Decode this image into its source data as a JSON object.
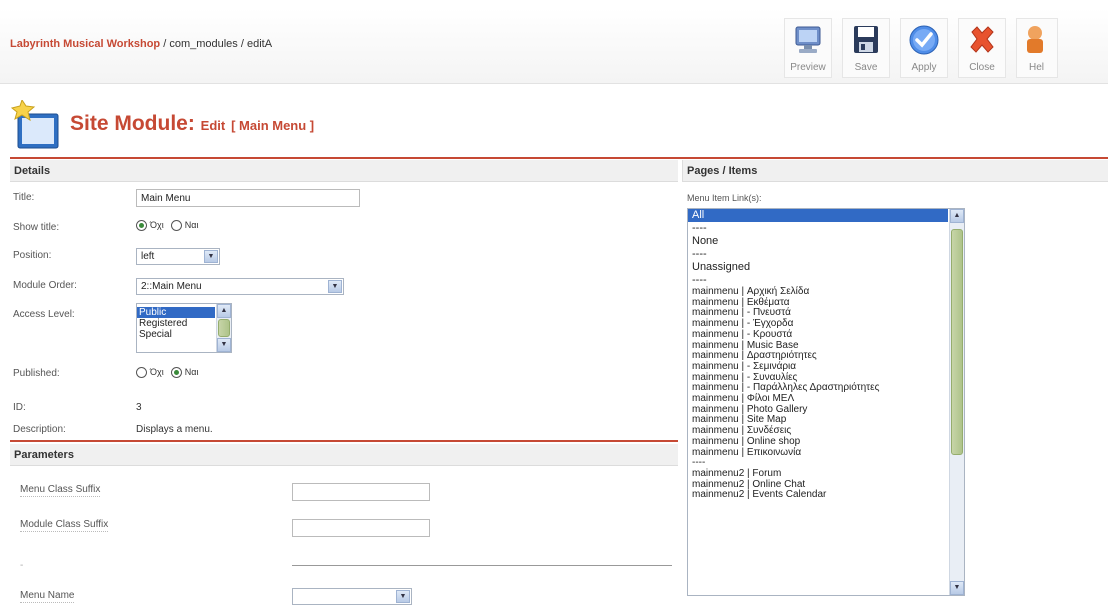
{
  "breadcrumb": {
    "site": "Labyrinth Musical Workshop",
    "path": " / com_modules / editA"
  },
  "toolbar": [
    {
      "name": "preview-button",
      "icon": "monitor-icon",
      "label": "Preview"
    },
    {
      "name": "save-button",
      "icon": "floppy-disk-icon",
      "label": "Save"
    },
    {
      "name": "apply-button",
      "icon": "checkmark-icon",
      "label": "Apply"
    },
    {
      "name": "close-button",
      "icon": "close-x-icon",
      "label": "Close"
    },
    {
      "name": "help-button",
      "icon": "help-person-icon",
      "label": "Hel"
    }
  ],
  "header": {
    "title": "Site Module: ",
    "edit": "Edit",
    "module": "[ Main Menu ]"
  },
  "details": {
    "heading": "Details",
    "title_label": "Title:",
    "title_value": "Main Menu",
    "show_title_label": "Show title:",
    "show_title_no": "Όχι",
    "show_title_yes": "Ναι",
    "position_label": "Position:",
    "position_value": "left",
    "order_label": "Module Order:",
    "order_value": "2::Main Menu",
    "access_label": "Access Level:",
    "access_options": [
      "Public",
      "Registered",
      "Special"
    ],
    "access_selected": "Public",
    "published_label": "Published:",
    "published_no": "Όχι",
    "published_yes": "Ναι",
    "id_label": "ID:",
    "id_value": "3",
    "desc_label": "Description:",
    "desc_value": "Displays a menu."
  },
  "parameters": {
    "heading": "Parameters",
    "menu_class_suffix": "Menu Class Suffix",
    "module_class_suffix": "Module Class Suffix",
    "dash": "-",
    "menu_name": "Menu Name"
  },
  "pages": {
    "heading": "Pages / Items",
    "link_label": "Menu Item Link(s):",
    "items_top": [
      "All",
      "----",
      "None",
      "----",
      "Unassigned",
      "----"
    ],
    "items": [
      "mainmenu | Αρχική Σελίδα",
      "mainmenu | Εκθέματα",
      "mainmenu |  - Πνευστά",
      "mainmenu |  - Έγχορδα",
      "mainmenu |  - Κρουστά",
      "mainmenu | Music Base",
      "mainmenu | Δραστηριότητες",
      "mainmenu |  - Σεμινάρια",
      "mainmenu |  - Συναυλίες",
      "mainmenu |  - Παράλληλες Δραστηριότητες",
      "mainmenu | Φίλοι ΜΕΛ",
      "mainmenu | Photo Gallery",
      "mainmenu | Site Map",
      "mainmenu | Συνδέσεις",
      "mainmenu | Online shop",
      "mainmenu | Επικοινωνία"
    ],
    "items_sep": "----",
    "items_tail": [
      "mainmenu2 | Forum",
      "mainmenu2 | Online Chat",
      "mainmenu2 | Events Calendar"
    ]
  }
}
